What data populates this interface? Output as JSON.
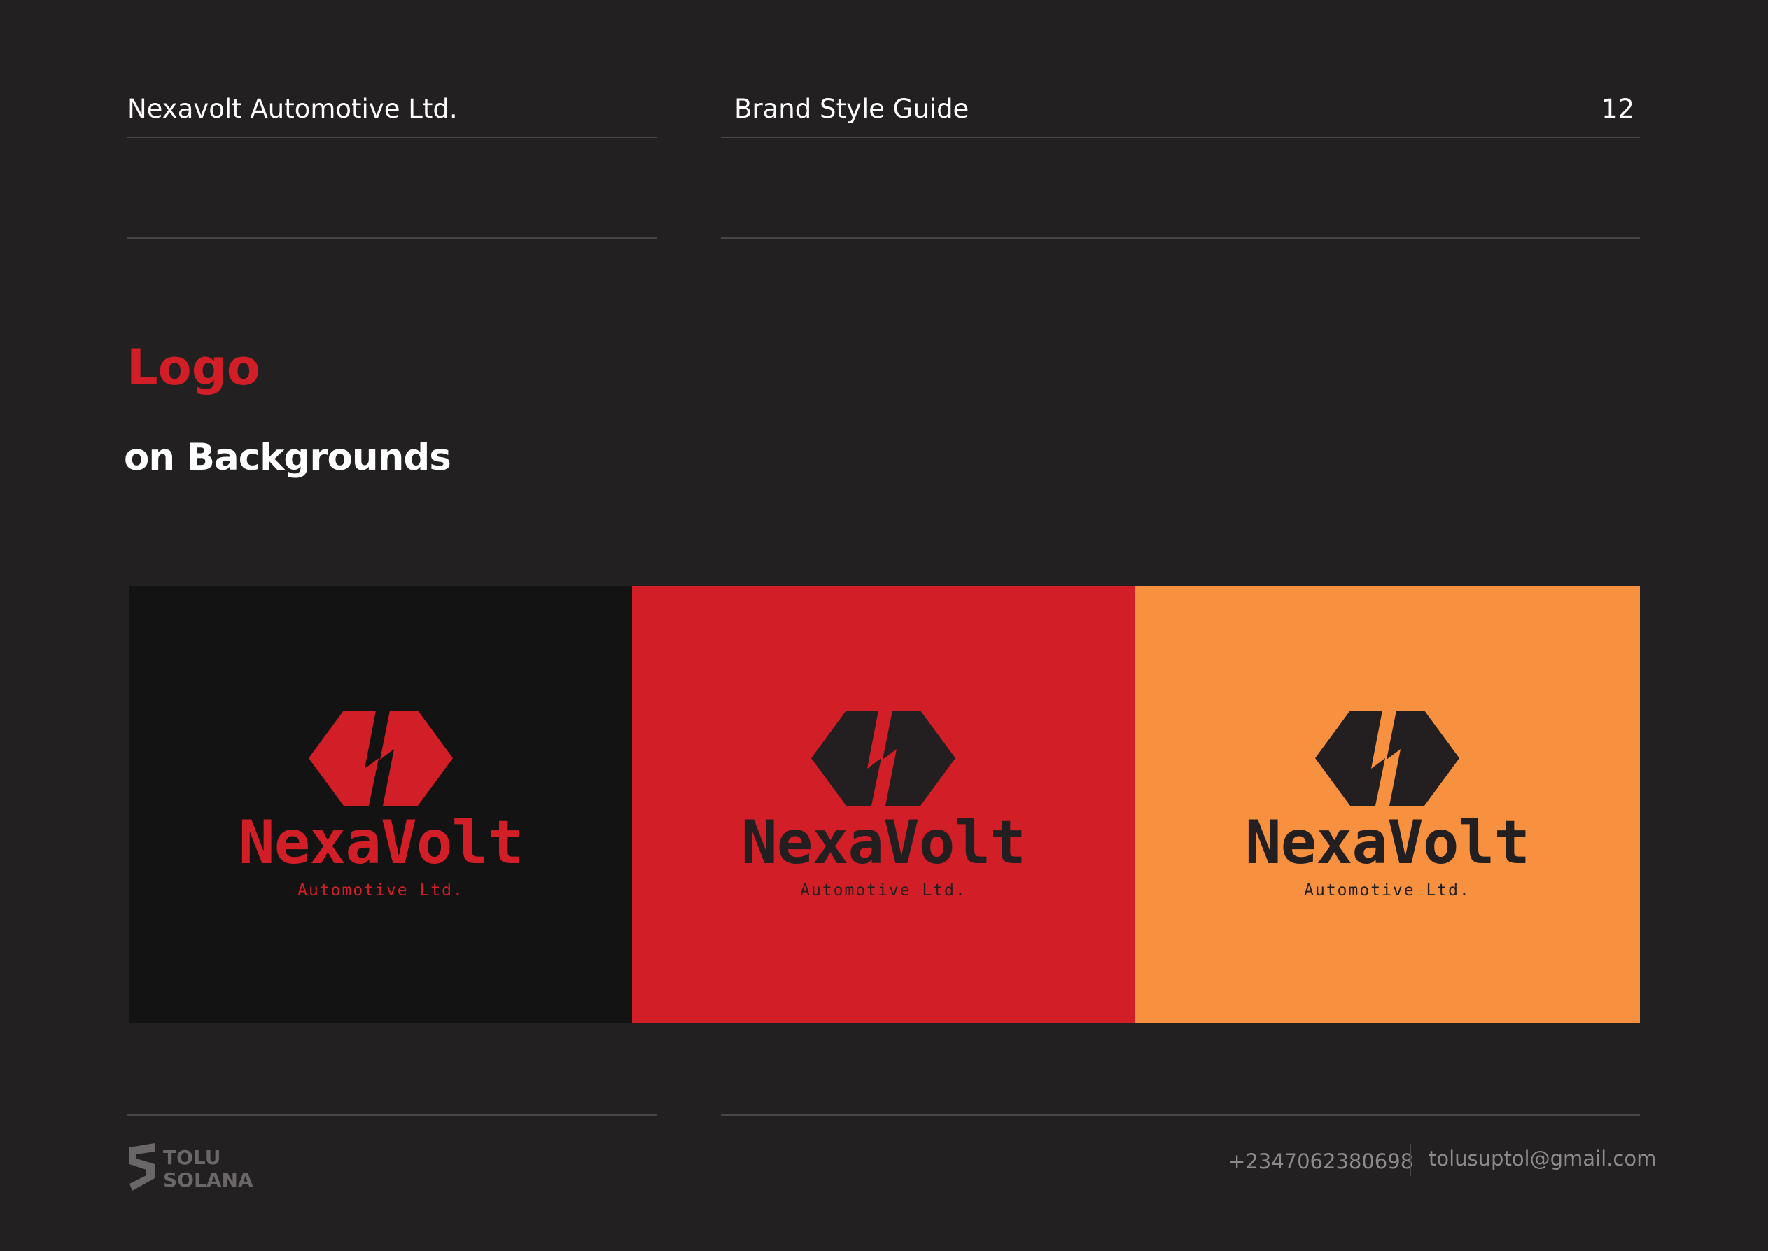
{
  "header": {
    "company": "Nexavolt Automotive Ltd.",
    "doc_title": "Brand Style Guide",
    "page_number": "12"
  },
  "section": {
    "title": "Logo",
    "subtitle": "on Backgrounds"
  },
  "panels": [
    {
      "background": "#131313",
      "mark_color": "#d21f27",
      "bolt_color": "#131313",
      "text_color": "#d21f27",
      "wordmark": "NexaVolt",
      "tagline": "Automotive Ltd."
    },
    {
      "background": "#d21f27",
      "mark_color": "#231f20",
      "bolt_color": "#d21f27",
      "text_color": "#231f20",
      "wordmark": "NexaVolt",
      "tagline": "Automotive Ltd."
    },
    {
      "background": "#f7913f",
      "mark_color": "#231f20",
      "bolt_color": "#f7913f",
      "text_color": "#231f20",
      "wordmark": "NexaVolt",
      "tagline": "Automotive Ltd."
    }
  ],
  "footer": {
    "brand_logo_text": [
      "TOLU",
      "SOLANA"
    ],
    "phone": "+2347062380698",
    "email": "tolusuptol@gmail.com"
  },
  "colors": {
    "page_background": "#232021",
    "accent_red": "#d21f27",
    "accent_orange": "#f7913f",
    "divider": "#4a4647",
    "muted_text": "#8e8a8b"
  },
  "icons": {
    "brand_mark": "hexagon-lightning-bolt-icon",
    "footer_logo": "tolu-solana-logo"
  }
}
